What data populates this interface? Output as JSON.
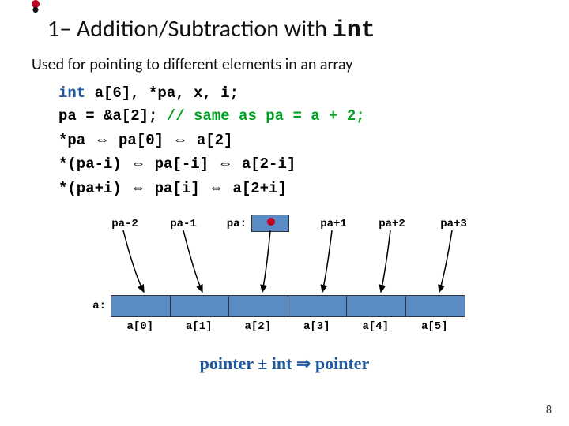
{
  "title_prefix": "1– Addition/Subtraction with ",
  "title_kw": "int",
  "bullet": "Used for pointing to different elements in an array",
  "code": {
    "l1a": "int",
    "l1b": " a[6], *pa, x, i;",
    "l2a": "pa = &a[2];  ",
    "l2b": "// same as pa = a + 2;",
    "l3a": "*pa ",
    "l3b": " pa[0] ",
    "l3c": " a[2]",
    "l4a": "*(pa-i) ",
    "l4b": " pa[-i] ",
    "l4c": " a[2-i]",
    "l5a": "*(pa+i) ",
    "l5b": " pa[i] ",
    "l5c": " a[2+i]"
  },
  "ptr_labels": [
    "pa-2",
    "pa-1",
    "pa:",
    "pa+1",
    "pa+2",
    "pa+3"
  ],
  "a_label": "a:",
  "idx_labels": [
    "a[0]",
    "a[1]",
    "a[2]",
    "a[3]",
    "a[4]",
    "a[5]"
  ],
  "formula": "pointer ± int ⇒ pointer",
  "pagenum": "8",
  "chart_data": {
    "type": "table",
    "title": "Pointer arithmetic mapping to array indices",
    "pointer_expressions": [
      "pa-2",
      "pa-1",
      "pa",
      "pa+1",
      "pa+2",
      "pa+3"
    ],
    "array_indices": [
      "a[0]",
      "a[1]",
      "a[2]",
      "a[3]",
      "a[4]",
      "a[5]"
    ],
    "mapping": [
      {
        "ptr": "pa-2",
        "index": "a[0]"
      },
      {
        "ptr": "pa-1",
        "index": "a[1]"
      },
      {
        "ptr": "pa",
        "index": "a[2]"
      },
      {
        "ptr": "pa+1",
        "index": "a[3]"
      },
      {
        "ptr": "pa+2",
        "index": "a[4]"
      },
      {
        "ptr": "pa+3",
        "index": "a[5]"
      }
    ]
  }
}
